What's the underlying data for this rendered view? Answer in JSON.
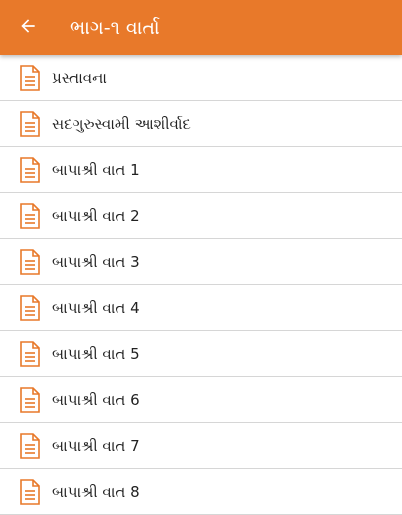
{
  "colors": {
    "appbar": "#e8792a",
    "icon": "#e8792a",
    "divider": "#d6d6d6",
    "text": "#222222"
  },
  "appbar": {
    "back_icon": "arrow-left-icon",
    "title": "ભાગ-૧ વાર્તા"
  },
  "list": {
    "item_icon": "document-icon",
    "items": [
      {
        "label": "પ્રસ્તાવના"
      },
      {
        "label": "સદગુરુસ્વામી આશીર્વાદ"
      },
      {
        "label": "બાપાશ્રી વાત 1"
      },
      {
        "label": "બાપાશ્રી વાત 2"
      },
      {
        "label": "બાપાશ્રી વાત 3"
      },
      {
        "label": "બાપાશ્રી વાત 4"
      },
      {
        "label": "બાપાશ્રી વાત 5"
      },
      {
        "label": "બાપાશ્રી વાત 6"
      },
      {
        "label": "બાપાશ્રી વાત 7"
      },
      {
        "label": "બાપાશ્રી વાત 8"
      }
    ]
  }
}
